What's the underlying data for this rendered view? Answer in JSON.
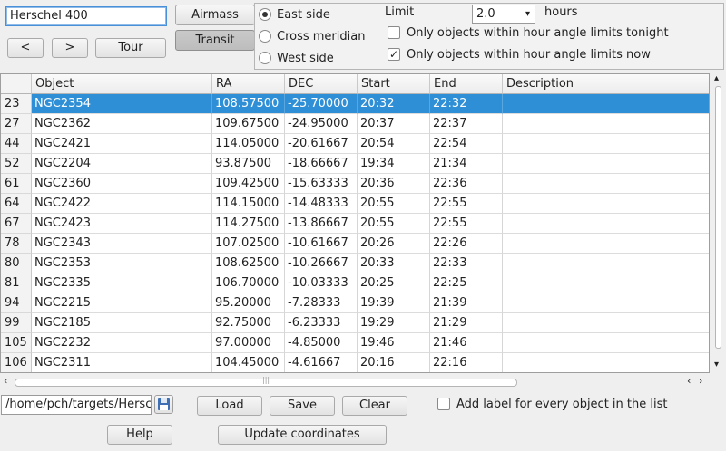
{
  "target_list": "Herschel 400",
  "buttons": {
    "prev": "<",
    "next": ">",
    "tour": "Tour",
    "airmass": "Airmass",
    "transit": "Transit",
    "load": "Load",
    "save": "Save",
    "clear": "Clear",
    "help": "Help",
    "update": "Update coordinates"
  },
  "radios": {
    "east": "East side",
    "cross": "Cross meridian",
    "west": "West side",
    "selected": "east"
  },
  "limit": {
    "label": "Limit",
    "value": "2.0",
    "unit": "hours",
    "tonight_label": "Only objects within hour angle limits tonight",
    "tonight_checked": false,
    "now_label": "Only objects within hour angle limits now",
    "now_checked": true
  },
  "table": {
    "columns": [
      "Object",
      "RA",
      "DEC",
      "Start",
      "End",
      "Description"
    ],
    "selected_index": 0,
    "rows": [
      {
        "n": "23",
        "object": "NGC2354",
        "ra": "108.57500",
        "dec": "-25.70000",
        "start": "20:32",
        "end": "22:32",
        "desc": ""
      },
      {
        "n": "27",
        "object": "NGC2362",
        "ra": "109.67500",
        "dec": "-24.95000",
        "start": "20:37",
        "end": "22:37",
        "desc": ""
      },
      {
        "n": "44",
        "object": "NGC2421",
        "ra": "114.05000",
        "dec": "-20.61667",
        "start": "20:54",
        "end": "22:54",
        "desc": ""
      },
      {
        "n": "52",
        "object": "NGC2204",
        "ra": "93.87500",
        "dec": "-18.66667",
        "start": "19:34",
        "end": "21:34",
        "desc": ""
      },
      {
        "n": "61",
        "object": "NGC2360",
        "ra": "109.42500",
        "dec": "-15.63333",
        "start": "20:36",
        "end": "22:36",
        "desc": ""
      },
      {
        "n": "64",
        "object": "NGC2422",
        "ra": "114.15000",
        "dec": "-14.48333",
        "start": "20:55",
        "end": "22:55",
        "desc": ""
      },
      {
        "n": "67",
        "object": "NGC2423",
        "ra": "114.27500",
        "dec": "-13.86667",
        "start": "20:55",
        "end": "22:55",
        "desc": ""
      },
      {
        "n": "78",
        "object": "NGC2343",
        "ra": "107.02500",
        "dec": "-10.61667",
        "start": "20:26",
        "end": "22:26",
        "desc": ""
      },
      {
        "n": "80",
        "object": "NGC2353",
        "ra": "108.62500",
        "dec": "-10.26667",
        "start": "20:33",
        "end": "22:33",
        "desc": ""
      },
      {
        "n": "81",
        "object": "NGC2335",
        "ra": "106.70000",
        "dec": "-10.03333",
        "start": "20:25",
        "end": "22:25",
        "desc": ""
      },
      {
        "n": "94",
        "object": "NGC2215",
        "ra": "95.20000",
        "dec": "-7.28333",
        "start": "19:39",
        "end": "21:39",
        "desc": ""
      },
      {
        "n": "99",
        "object": "NGC2185",
        "ra": "92.75000",
        "dec": "-6.23333",
        "start": "19:29",
        "end": "21:29",
        "desc": ""
      },
      {
        "n": "105",
        "object": "NGC2232",
        "ra": "97.00000",
        "dec": "-4.85000",
        "start": "19:46",
        "end": "21:46",
        "desc": ""
      },
      {
        "n": "106",
        "object": "NGC2311",
        "ra": "104.45000",
        "dec": "-4.61667",
        "start": "20:16",
        "end": "22:16",
        "desc": ""
      }
    ]
  },
  "file_path": "/home/pch/targets/Herschel",
  "add_label": {
    "text": "Add label for every object in the list",
    "checked": false
  },
  "colors": {
    "selection": "#2f8fd6",
    "focus": "#4a8fd9"
  }
}
